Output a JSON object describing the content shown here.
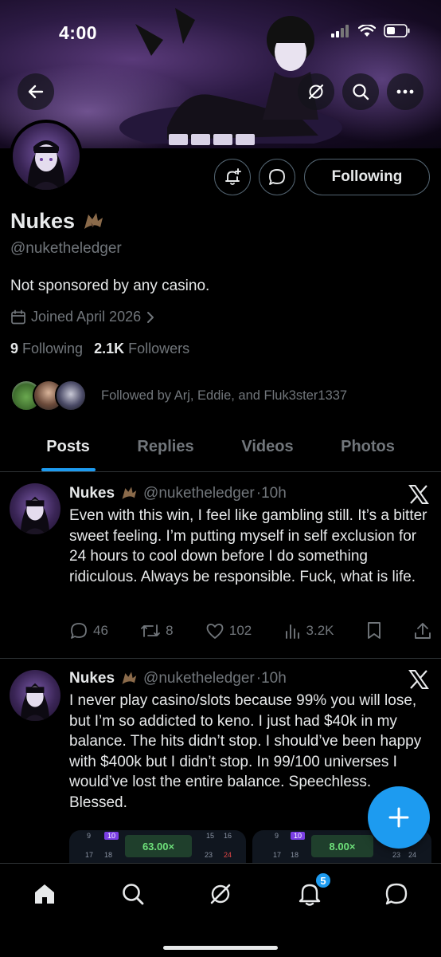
{
  "status_bar": {
    "time": "4:00"
  },
  "profile": {
    "name": "Nukes",
    "handle": "@nuketheledger",
    "bio": "Not sponsored by any casino.",
    "joined": "Joined April 2026",
    "following_count": "9",
    "following_label": "Following",
    "followers_count": "2.1K",
    "followers_label": "Followers",
    "followed_by": "Followed by Arj, Eddie, and Fluk3ster1337",
    "follow_button_label": "Following"
  },
  "tabs": [
    {
      "label": "Posts",
      "active": true
    },
    {
      "label": "Replies",
      "active": false
    },
    {
      "label": "Videos",
      "active": false
    },
    {
      "label": "Photos",
      "active": false
    }
  ],
  "posts": [
    {
      "name": "Nukes",
      "handle": "@nuketheledger",
      "time": "·10h",
      "text": "Even with this win, I feel like gambling still. It’s a bitter sweet feeling. I’m putting myself in self exclusion for 24 hours to cool down before I do something ridiculous. Always be responsible. Fuck, what is life.",
      "replies": "46",
      "reposts": "8",
      "likes": "102",
      "views": "3.2K"
    },
    {
      "name": "Nukes",
      "handle": "@nuketheledger",
      "time": "·10h",
      "text": "I never play casino/slots because 99% you will lose, but I’m so addicted to keno. I just had $40k in my balance. The hits didn’t stop. I should’ve been happy with $400k but I didn’t stop. In 99/100 universes I would’ve lost the entire balance. Speechless. Blessed.",
      "media": [
        {
          "multiplier": "63.00×",
          "cells": [
            "9",
            "10",
            "17",
            "18",
            "15",
            "16",
            "23",
            "24"
          ]
        },
        {
          "multiplier": "8.00×",
          "cells": [
            "9",
            "10",
            "17",
            "18",
            "23",
            "24"
          ]
        }
      ]
    }
  ],
  "nav": {
    "notifications_badge": "5"
  },
  "icons": [
    "back-arrow-icon",
    "grok-icon",
    "search-icon",
    "more-icon",
    "notification-bell-plus-icon",
    "message-icon",
    "calendar-icon",
    "chevron-right-icon",
    "x-logo-icon",
    "reply-icon",
    "repost-icon",
    "like-icon",
    "views-icon",
    "bookmark-icon",
    "share-icon",
    "compose-plus-icon",
    "home-icon",
    "explore-icon",
    "grok-nav-icon",
    "bell-icon",
    "messages-icon"
  ],
  "colors": {
    "accent": "#1d9bf0",
    "text": "#e7e9ea",
    "muted": "#71767b",
    "border": "#2f3336",
    "background": "#000000"
  }
}
